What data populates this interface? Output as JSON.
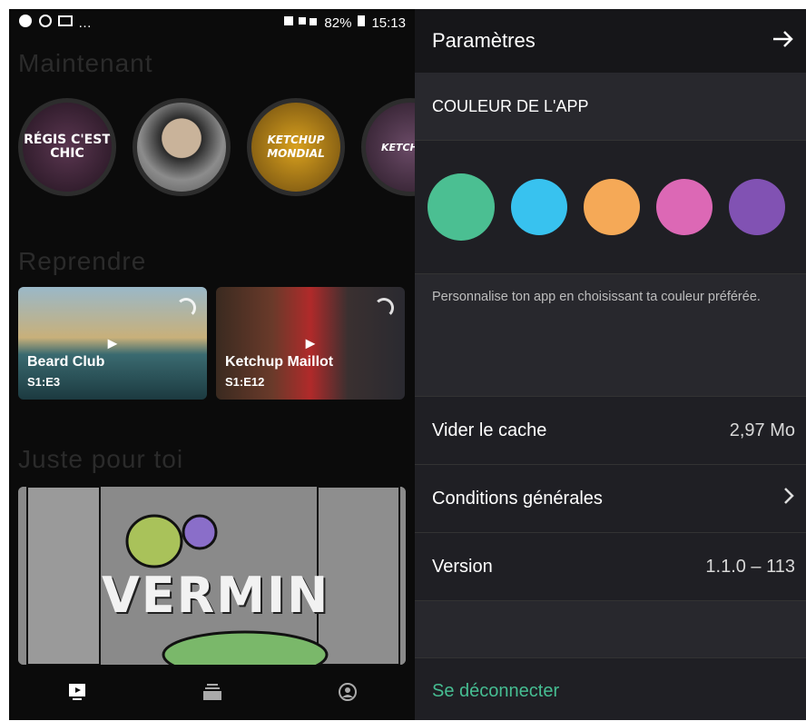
{
  "status_bar": {
    "left": "…",
    "battery": "82%",
    "time": "15:13"
  },
  "home": {
    "section_now": "Maintenant",
    "section_resume": "Reprendre",
    "section_foryou": "Juste pour toi",
    "shows": [
      {
        "label": "RÉGIS C'EST CHIC"
      },
      {
        "label": ""
      },
      {
        "label": "KETCHUP MONDIAL"
      },
      {
        "label": "KETCH MA"
      }
    ],
    "resume_cards": [
      {
        "title": "Beard Club",
        "episode": "S1:E3"
      },
      {
        "title": "Ketchup Maillot",
        "episode": "S1:E12"
      }
    ],
    "feature": {
      "title": "VERMIN"
    }
  },
  "settings": {
    "title": "Paramètres",
    "app_color_heading": "COULEUR DE L'APP",
    "colors": [
      "#4bbf92",
      "#38c2ef",
      "#f5a957",
      "#dc68b5",
      "#8152b3"
    ],
    "color_description": "Personnalise ton app en choisissant ta couleur préférée.",
    "clear_cache_label": "Vider le cache",
    "clear_cache_value": "2,97 Mo",
    "terms_label": "Conditions générales",
    "version_label": "Version",
    "version_value": "1.1.0 – 113",
    "logout_label": "Se déconnecter"
  }
}
